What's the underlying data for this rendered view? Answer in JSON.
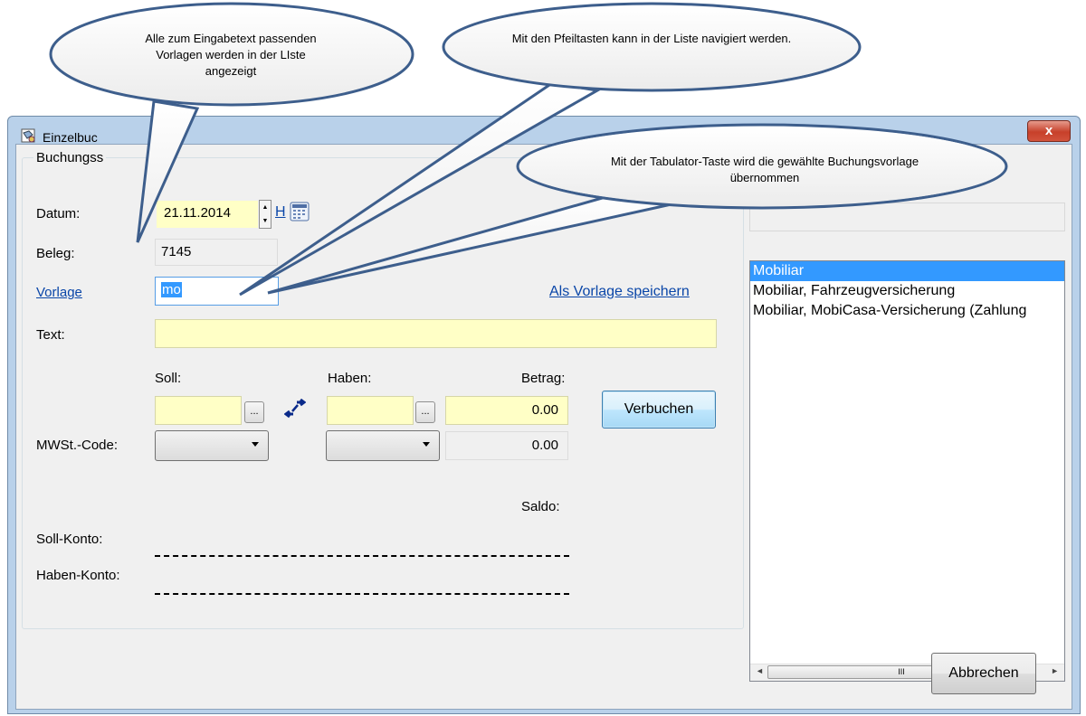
{
  "callouts": {
    "left": "Alle zum Eingabetext passenden Vorlagen werden in der LIste angezeigt",
    "middle": "Mit den Pfeiltasten kann in der Liste navigiert werden.",
    "right": "Mit der Tabulator-Taste wird die gewählte Buchungsvorlage übernommen"
  },
  "window": {
    "title": "Einzelbuc",
    "close_label": "x"
  },
  "group": {
    "legend": "Buchungss"
  },
  "form": {
    "datum_label": "Datum:",
    "datum_value": "21.11.2014",
    "heute_link": "H",
    "beleg_label": "Beleg:",
    "beleg_value": "7145",
    "vorlage_label": "Vorlage",
    "vorlage_value": "mo",
    "save_template_link": "Als Vorlage speichern",
    "text_label": "Text:",
    "text_value": "",
    "soll_label": "Soll:",
    "haben_label": "Haben:",
    "betrag_label": "Betrag:",
    "soll_value": "",
    "haben_value": "",
    "betrag_value": "0.00",
    "mwst_label": "MWSt.-Code:",
    "mwst_betrag": "0.00",
    "browse_label": "...",
    "saldo_label": "Saldo:",
    "soll_konto_label": "Soll-Konto:",
    "haben_konto_label": "Haben-Konto:"
  },
  "buttons": {
    "verbuchen": "Verbuchen",
    "abbrechen": "Abbrechen"
  },
  "template_list": {
    "items": [
      {
        "label": "Mobiliar",
        "selected": true
      },
      {
        "label": "Mobiliar, Fahrzeugversicherung",
        "selected": false
      },
      {
        "label": "Mobiliar, MobiCasa-Versicherung (Zahlung",
        "selected": false
      }
    ],
    "scroll_thumb": "III"
  },
  "colors": {
    "selection": "#3399ff",
    "field_yellow": "#ffffc6",
    "link": "#0a46a8"
  }
}
